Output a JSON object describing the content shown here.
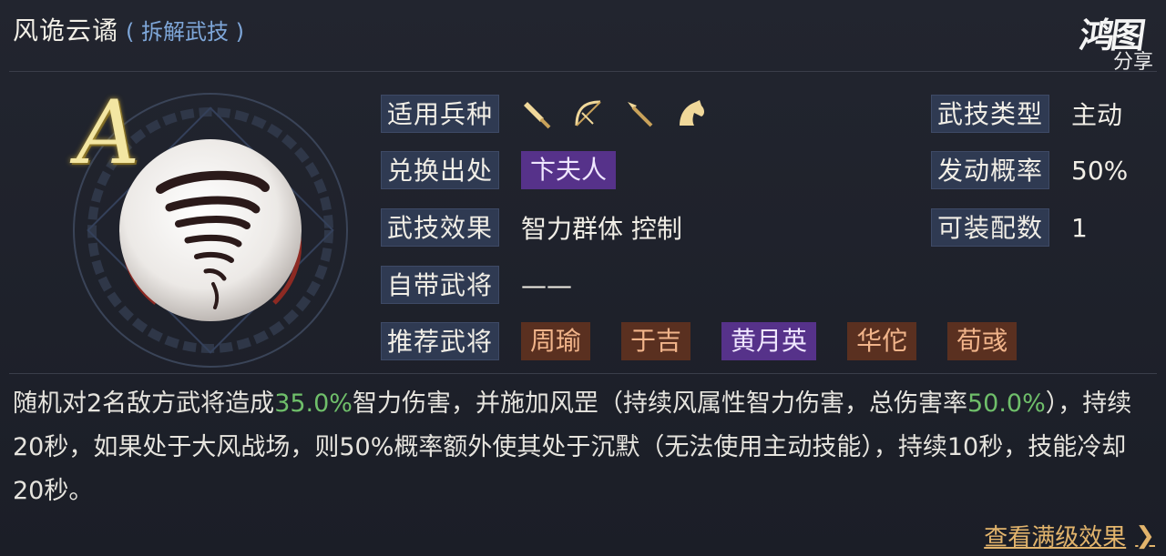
{
  "header": {
    "title": "风诡云谲",
    "subtitle": "( 拆解武技 )",
    "brand_logo_text": "鸿图之下",
    "share_label": "分享"
  },
  "skill": {
    "grade": "A",
    "troop_label": "适用兵种",
    "troop_icons": [
      "sword-icon",
      "bow-icon",
      "spear-icon",
      "horse-icon"
    ],
    "source_label": "兑换出处",
    "source_value": "卞夫人",
    "effect_label": "武技效果",
    "effect_value": "智力群体 控制",
    "native_label": "自带武将",
    "native_value": "——",
    "recommend_label": "推荐武将",
    "recommend": [
      {
        "name": "周瑜",
        "color": "brown"
      },
      {
        "name": "于吉",
        "color": "brown"
      },
      {
        "name": "黄月英",
        "color": "purple"
      },
      {
        "name": "华佗",
        "color": "brown"
      },
      {
        "name": "荀彧",
        "color": "brown"
      }
    ],
    "type_label": "武技类型",
    "type_value": "主动",
    "chance_label": "发动概率",
    "chance_value": "50%",
    "equip_label": "可装配数",
    "equip_value": "1"
  },
  "description": {
    "part1": "随机对2名敌方武将造成",
    "hl1": "35.0%",
    "part2": "智力伤害，并施加风罡（持续风属性智力伤害，总伤害率",
    "hl2": "50.0%",
    "part3": "），持续20秒，如果处于大风战场，则50%概率额外使其处于沉默（无法使用主动技能），持续10秒，技能冷却20秒。"
  },
  "footer": {
    "more_label": "查看满级效果",
    "more_icon": "chevron-right-icon"
  },
  "colors": {
    "highlight": "#6fbf6a",
    "link": "#e2b46c",
    "purple_tag": "#56328a",
    "brown_tag": "#5a3020"
  }
}
